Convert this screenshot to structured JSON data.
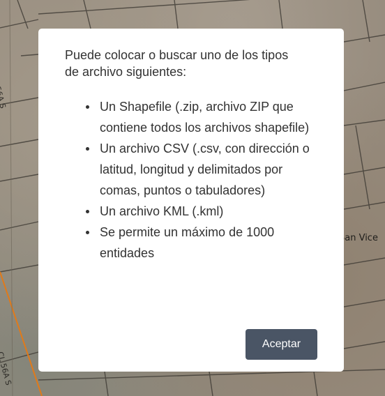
{
  "map": {
    "street_label_1": "CL 56A S",
    "street_label_2": "CL 56A S",
    "street_label_3": "San Vice"
  },
  "dialog": {
    "intro": "Puede colocar o buscar uno de los tipos de archivo siguientes:",
    "items": [
      "Un Shapefile (.zip, archivo ZIP que contiene todos los archivos shapefile)",
      "Un archivo CSV (.csv, con dirección o latitud, longitud y delimitados por comas, puntos o tabuladores)",
      "Un archivo KML (.kml)",
      "Se permite un máximo de 1000 entidades"
    ],
    "accept_label": "Aceptar",
    "accent_color": "#4a5565"
  }
}
